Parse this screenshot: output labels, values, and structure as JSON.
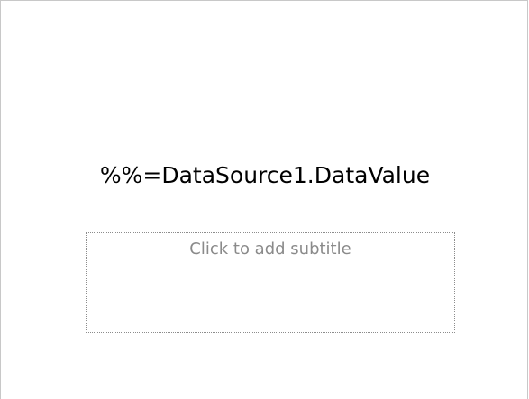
{
  "slide": {
    "title": "%%=DataSource1.DataValue",
    "subtitle_placeholder": "Click to add subtitle"
  },
  "colors": {
    "background": "#ffffff",
    "title_text": "#000000",
    "placeholder_text": "#8a8a8a",
    "placeholder_border": "#8c8c8c"
  }
}
